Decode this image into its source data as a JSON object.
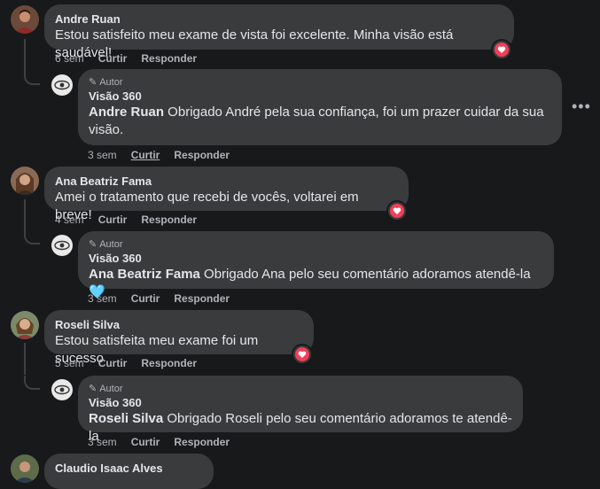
{
  "comments": [
    {
      "author": "Andre Ruan",
      "text": "Estou satisfeito meu exame de vista foi excelente. Minha visão está saudável!",
      "time": "6 sem",
      "like": "Curtir",
      "reply": "Responder",
      "reply_item": {
        "badge": "Autor",
        "author": "Visão 360",
        "mention": "Andre Ruan",
        "text_line1": " Obrigado André pela sua confiança, foi um prazer cuidar da sua",
        "text_line2": "visão.",
        "time": "3 sem",
        "like": "Curtir",
        "reply": "Responder"
      }
    },
    {
      "author": "Ana Beatriz Fama",
      "text": "Amei o tratamento que recebi de vocês, voltarei em breve!",
      "time": "4 sem",
      "like": "Curtir",
      "reply": "Responder",
      "reply_item": {
        "badge": "Autor",
        "author": "Visão 360",
        "mention": "Ana Beatriz Fama",
        "text": " Obrigado Ana pelo seu comentário adoramos atendê-la 🩵",
        "time": "3 sem",
        "like": "Curtir",
        "reply": "Responder"
      }
    },
    {
      "author": "Roseli Silva",
      "text": "Estou satisfeita meu exame foi um sucesso",
      "time": "5 sem",
      "like": "Curtir",
      "reply": "Responder",
      "reply_item": {
        "badge": "Autor",
        "author": "Visão 360",
        "mention": "Roseli Silva",
        "text": " Obrigado Roseli pelo seu comentário adoramos te atendê-la",
        "time": "3 sem",
        "like": "Curtir",
        "reply": "Responder"
      }
    },
    {
      "author": "Claudio Isaac Alves"
    }
  ],
  "colors": {
    "background": "#18191a",
    "bubble": "#3a3b3c",
    "text": "#e4e6eb",
    "secondary": "#b0b3b8",
    "heart": "#f33e58"
  }
}
